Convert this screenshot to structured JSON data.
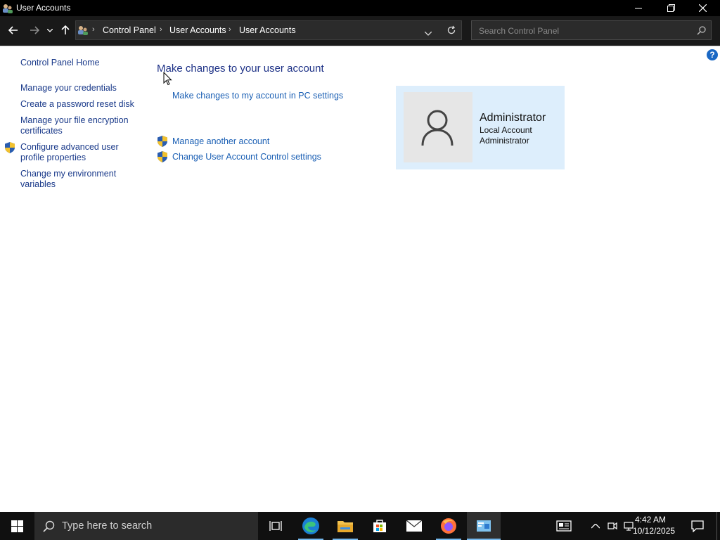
{
  "window": {
    "title": "User Accounts"
  },
  "address": {
    "crumbs": [
      "Control Panel",
      "User Accounts",
      "User Accounts"
    ],
    "search_placeholder": "Search Control Panel"
  },
  "left_pane": {
    "home": "Control Panel Home",
    "links": [
      "Manage your credentials",
      "Create a password reset disk",
      "Manage your file encryption certificates",
      "Configure advanced user profile properties",
      "Change my environment variables"
    ]
  },
  "main": {
    "heading": "Make changes to your user account",
    "pc_settings_link": "Make changes to my account in PC settings",
    "manage_another": "Manage another account",
    "uac_settings": "Change User Account Control settings"
  },
  "account": {
    "name": "Administrator",
    "type": "Local Account",
    "role": "Administrator"
  },
  "help": {
    "label": "?"
  },
  "taskbar": {
    "search_placeholder": "Type here to search",
    "time": "4:42 AM",
    "date": "10/12/2025"
  },
  "colors": {
    "link": "#1a5fb4",
    "heading": "#1e3287",
    "card_bg": "#ddeefc",
    "titlebar": "#000000",
    "taskbar": "#101010"
  }
}
